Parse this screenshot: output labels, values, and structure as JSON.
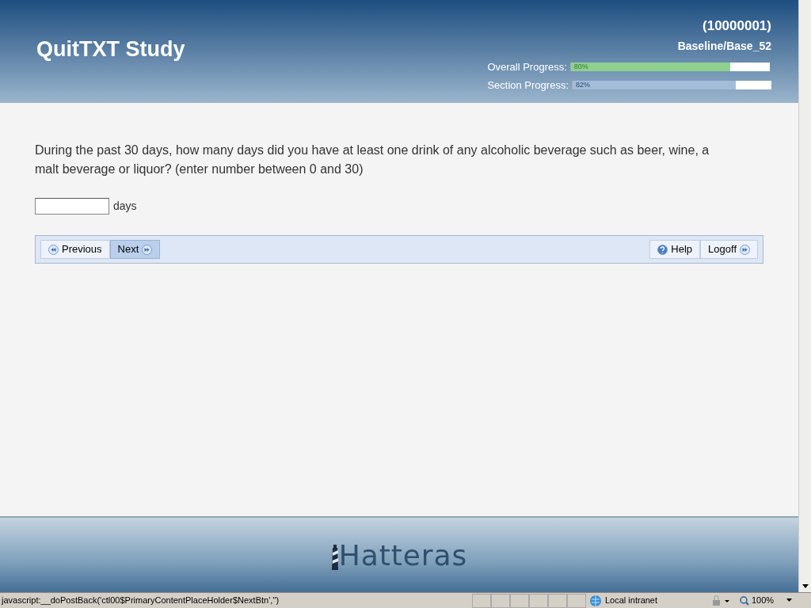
{
  "header": {
    "title": "QuitTXT Study",
    "participant_id": "(10000001)",
    "section": "Baseline/Base_52",
    "progress": [
      {
        "label": "Overall Progress:",
        "level": 0.8,
        "reading": "80%",
        "color": "#8fd08f"
      },
      {
        "label": "Section Progress:",
        "level": 0.82,
        "reading": "82%",
        "color": "#a3bcd8"
      }
    ]
  },
  "question": {
    "text": "During the past 30 days, how many days did you have at least one drink of any alcoholic beverage such as beer, wine, a malt beverage or liquor? (enter number between 0 and 30)",
    "unit": "days"
  },
  "nav": {
    "left": [
      {
        "label": "Previous",
        "kind": "back",
        "highlighted": false
      },
      {
        "label": "Next",
        "kind": "forward",
        "highlighted": true
      }
    ],
    "right": [
      {
        "label": "Help",
        "kind": "help",
        "highlighted": false
      },
      {
        "label": "Logoff",
        "kind": "forward",
        "highlighted": false
      }
    ]
  },
  "footer": {
    "logo": "Hatteras"
  },
  "status_bar": {
    "text": "javascript:__doPostBack('ctl00$PrimaryContentPlaceHolder$NextBtn','')",
    "zone": "Local intranet",
    "zoom": "100%"
  }
}
